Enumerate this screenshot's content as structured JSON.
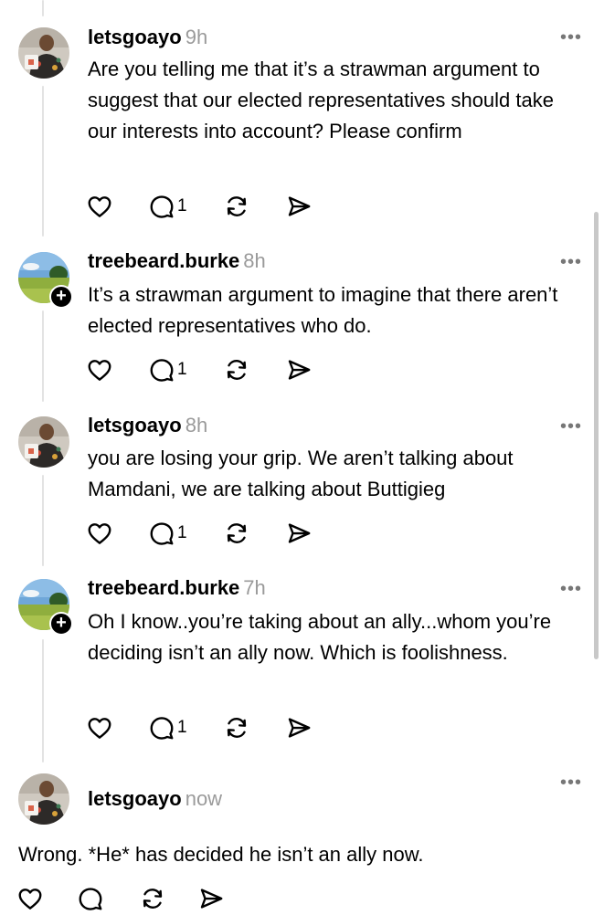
{
  "icons": {
    "like": "heart-icon",
    "reply": "speech-bubble-icon",
    "repost": "repost-arrows-icon",
    "share": "send-arrow-icon",
    "more": "more-dots-icon",
    "follow": "plus-icon"
  },
  "more_label": "•••",
  "follow_label": "+",
  "posts": [
    {
      "username": "letsgoayo",
      "time": "9h",
      "text": "Are you telling me that it’s a strawman argument to suggest that our elected representatives should take our interests into account? Please confirm",
      "reply_count": "1"
    },
    {
      "username": "treebeard.burke",
      "time": "8h",
      "text": "It’s a strawman argument to imagine that there aren’t elected representatives who do.",
      "reply_count": "1"
    },
    {
      "username": "letsgoayo",
      "time": "8h",
      "text": "you are losing your grip. We aren’t talking about Mamdani, we are talking about Buttigieg",
      "reply_count": "1"
    },
    {
      "username": "treebeard.burke",
      "time": "7h",
      "text": "Oh I know..you’re taking about an ally...whom you’re deciding isn’t an ally now.  Which is foolishness.",
      "reply_count": "1"
    },
    {
      "username": "letsgoayo",
      "time": "now",
      "text": "Wrong. *He* has decided he isn’t an ally now.",
      "reply_count": ""
    }
  ]
}
